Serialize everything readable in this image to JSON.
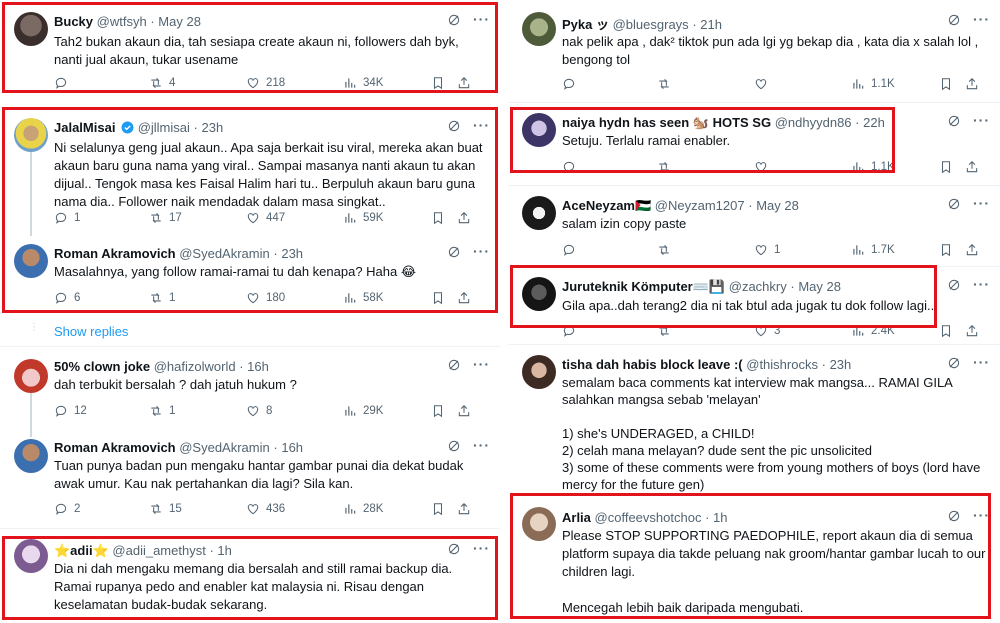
{
  "colors": {
    "highlight": "#e3131b",
    "accent": "#1d9bf0",
    "muted": "#536471",
    "text": "#0f1419"
  },
  "left": {
    "tweets": [
      {
        "name": "Bucky",
        "handle": "@wtfsyh",
        "time": "May 28",
        "text": "Tah2 bukan akaun dia, tah sesiapa create akaun ni, followers dah byk, nanti jual akaun, tukar usename",
        "stats": {
          "reply": "",
          "retweet": "4",
          "like": "218",
          "views": "34K"
        }
      },
      {
        "name": "JalalMisai",
        "handle": "@jllmisai",
        "time": "23h",
        "verified": true,
        "text": "Ni selalunya geng jual akaun.. Apa saja berkait isu viral, mereka akan buat akaun baru guna nama yang viral.. Sampai masanya nanti akaun tu akan dijual.. Tengok masa kes Faisal Halim hari tu.. Berpuluh akaun baru guna nama dia.. Follower naik mendadak dalam masa singkat..",
        "stats": {
          "reply": "1",
          "retweet": "17",
          "like": "447",
          "views": "59K"
        }
      },
      {
        "name": "Roman Akramovich",
        "handle": "@SyedAkramin",
        "time": "23h",
        "text": "Masalahnya, yang follow ramai-ramai tu dah kenapa? Haha 😂",
        "stats": {
          "reply": "6",
          "retweet": "1",
          "like": "180",
          "views": "58K"
        }
      },
      {
        "name": "50% clown joke",
        "handle": "@hafizolworld",
        "time": "16h",
        "text": "dah terbukit bersalah ? dah jatuh hukum ?",
        "stats": {
          "reply": "12",
          "retweet": "1",
          "like": "8",
          "views": "29K"
        }
      },
      {
        "name": "Roman Akramovich",
        "handle": "@SyedAkramin",
        "time": "16h",
        "text": "Tuan punya badan pun mengaku hantar gambar punai dia dekat budak awak umur. Kau nak pertahankan dia lagi? Sila kan.",
        "stats": {
          "reply": "2",
          "retweet": "15",
          "like": "436",
          "views": "28K"
        }
      },
      {
        "name": "⭐adii⭐",
        "handle": "@adii_amethyst",
        "time": "1h",
        "text": "Dia ni dah mengaku memang dia bersalah and still ramai backup dia. Ramai rupanya pedo and enabler kat malaysia ni. Risau dengan keselamatan budak-budak sekarang."
      }
    ],
    "show_replies": "Show replies"
  },
  "right": {
    "tweets": [
      {
        "name": "Pyka ッ",
        "handle": "@bluesgrays",
        "time": "21h",
        "text": "nak pelik apa , dak² tiktok pun ada lgi yg bekap dia , kata dia x salah lol , bengong tol",
        "stats": {
          "reply": "",
          "retweet": "",
          "like": "",
          "views": "1.1K"
        }
      },
      {
        "name": "naiya hydn has seen 🐿️ HOTS SG",
        "handle": "@ndhyydn86",
        "time": "22h",
        "text": "Setuju. Terlalu ramai enabler.",
        "stats": {
          "reply": "",
          "retweet": "",
          "like": "",
          "views": "1.1K"
        }
      },
      {
        "name": "AceNeyzam🇵🇸",
        "handle": "@Neyzam1207",
        "time": "May 28",
        "text": "salam izin copy paste",
        "stats": {
          "reply": "",
          "retweet": "",
          "like": "1",
          "views": "1.7K"
        }
      },
      {
        "name": "Juruteknik Kömputer⌨️💾",
        "handle": "@zachkry",
        "time": "May 28",
        "text": "Gila apa..dah terang2 dia ni tak btul ada jugak tu dok follow lagi..",
        "stats": {
          "reply": "",
          "retweet": "",
          "like": "3",
          "views": "2.4K"
        }
      },
      {
        "name": "tisha dah habis block leave :(",
        "handle": "@thishrocks",
        "time": "23h",
        "text": "semalam baca comments kat interview mak mangsa... RAMAI GILA salahkan mangsa sebab 'melayan'\n\n1) she's UNDERAGED, a CHILD!\n2) celah mana melayan? dude sent the pic unsolicited\n3) some of these comments were from young mothers of boys (lord have mercy for the future gen)"
      },
      {
        "name": "Arlia",
        "handle": "@coffeevshotchoc",
        "time": "1h",
        "text": "Please STOP SUPPORTING PAEDOPHILE, report akaun dia di semua platform supaya dia takde peluang nak groom/hantar gambar lucah to our children lagi.\n\nMencegah lebih baik daripada mengubati."
      }
    ]
  }
}
